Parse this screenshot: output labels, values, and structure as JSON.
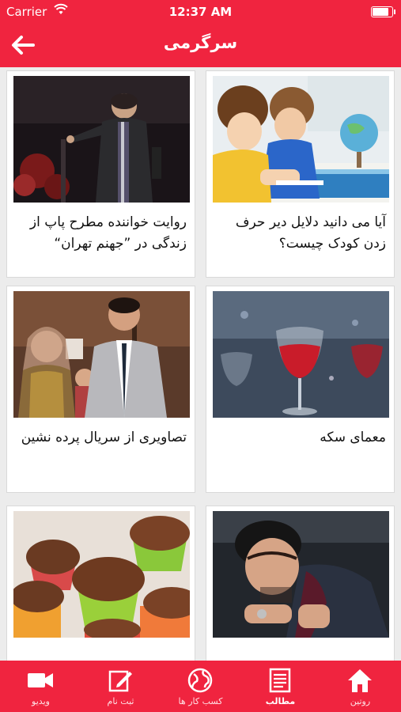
{
  "status_bar": {
    "carrier": "Carrier",
    "time": "12:37 AM",
    "battery_level": 0.9
  },
  "nav": {
    "title": "سرگرمی",
    "back_icon": "arrow-left-icon"
  },
  "articles": [
    {
      "caption": "آیا می دانید دلایل دیر حرف زدن کودک چیست؟",
      "image": "children-drawing-photo"
    },
    {
      "caption": "روایت خواننده مطرح پاپ از زندگی در ”جهنم تهران“",
      "image": "singer-on-stage-photo"
    },
    {
      "caption": "معمای سکه",
      "image": "wine-glasses-photo"
    },
    {
      "caption": "تصاویری از سریال پرده نشین",
      "image": "tv-series-cast-photo"
    },
    {
      "caption": "",
      "image": "man-portrait-photo"
    },
    {
      "caption": "",
      "image": "muffins-photo"
    }
  ],
  "tabs": [
    {
      "label": "روتین",
      "icon": "home-icon",
      "active": false
    },
    {
      "label": "مطالب",
      "icon": "articles-icon",
      "active": true
    },
    {
      "label": "کسب کار ها",
      "icon": "globe-icon",
      "active": false
    },
    {
      "label": "ثبت نام",
      "icon": "edit-icon",
      "active": false
    },
    {
      "label": "ویدیو",
      "icon": "video-camera-icon",
      "active": false
    }
  ],
  "colors": {
    "brand": "#f0243f",
    "background": "#ececec",
    "card": "#ffffff"
  }
}
